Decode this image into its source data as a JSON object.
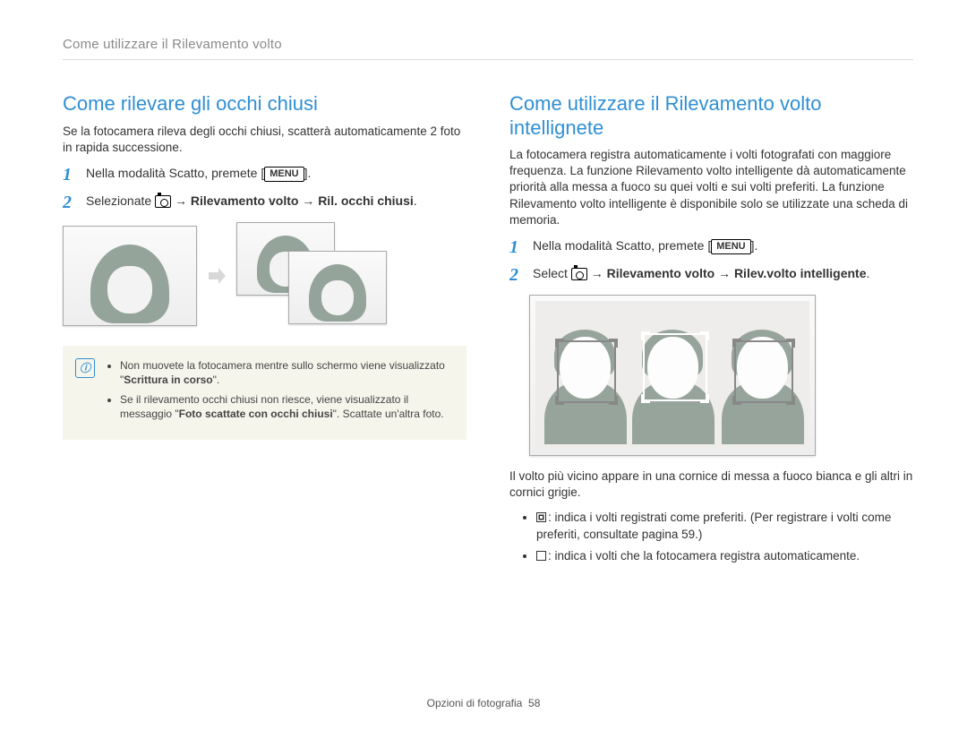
{
  "breadcrumb": "Come utilizzare il Rilevamento volto",
  "left": {
    "title": "Come rilevare gli occhi chiusi",
    "intro": "Se la fotocamera rileva degli occhi chiusi, scatterà automaticamente 2 foto in rapida successione.",
    "step1_a": "Nella modalità Scatto, premete [",
    "menu": "MENU",
    "step1_b": "].",
    "step2_a": "Selezionate ",
    "step2_b": " → Rilevamento volto → Ril. occhi chiusi",
    "step2_c": ".",
    "note1_a": "Non muovete la fotocamera mentre sullo schermo viene visualizzato \"",
    "note1_b": "Scrittura in corso",
    "note1_c": "\".",
    "note2_a": "Se il rilevamento occhi chiusi non riesce, viene visualizzato il messaggio \"",
    "note2_b": "Foto scattate con occhi chiusi",
    "note2_c": "\". Scattate un'altra foto."
  },
  "right": {
    "title": "Come utilizzare il Rilevamento volto intellignete",
    "intro": "La fotocamera registra automaticamente i volti fotografati con maggiore frequenza. La funzione Rilevamento volto intelligente dà automaticamente priorità alla messa a fuoco su quei volti e sui volti preferiti. La funzione Rilevamento volto intelligente è disponibile solo se utilizzate una scheda di memoria.",
    "step1_a": "Nella modalità Scatto, premete [",
    "menu": "MENU",
    "step1_b": "].",
    "step2_a": "Select ",
    "step2_b": " → Rilevamento volto → Rilev.volto intelligente",
    "step2_c": ".",
    "caption": "Il volto più vicino appare in una cornice di messa a fuoco bianca e gli altri in cornici grigie.",
    "b1": ": indica i volti registrati come preferiti. (Per registrare i volti come preferiti, consultate pagina 59.)",
    "b2": ": indica i volti che la fotocamera registra automaticamente."
  },
  "footer": {
    "section": "Opzioni di fotografia",
    "page": "58"
  }
}
